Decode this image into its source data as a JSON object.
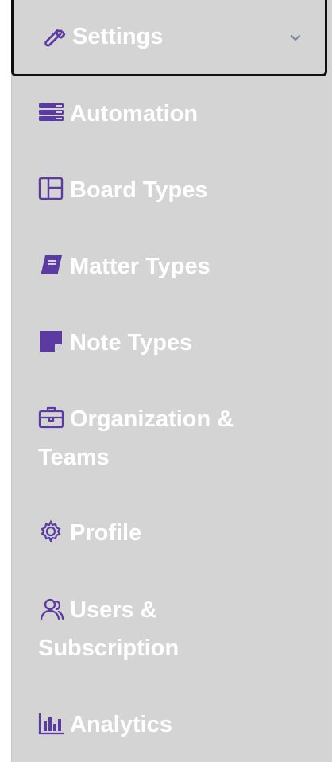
{
  "header": {
    "label": "Settings",
    "icon": "wrench-icon",
    "expanded_icon": "chevron-down-icon"
  },
  "colors": {
    "accent": "#5b3aa3",
    "background": "#d4d4d4",
    "text": "#ffffff",
    "header_border": "#111111",
    "chevron": "#7a88a3"
  },
  "menu": {
    "items": [
      {
        "label": "Automation",
        "icon": "automation-icon"
      },
      {
        "label": "Board Types",
        "icon": "board-layout-icon"
      },
      {
        "label": "Matter Types",
        "icon": "book-icon"
      },
      {
        "label": "Note Types",
        "icon": "sticky-note-icon"
      },
      {
        "label": "Organization & Teams",
        "icon": "briefcase-icon"
      },
      {
        "label": "Profile",
        "icon": "gear-icon"
      },
      {
        "label": "Users & Subscription",
        "icon": "users-icon"
      },
      {
        "label": "Analytics",
        "icon": "bar-chart-icon"
      }
    ]
  }
}
